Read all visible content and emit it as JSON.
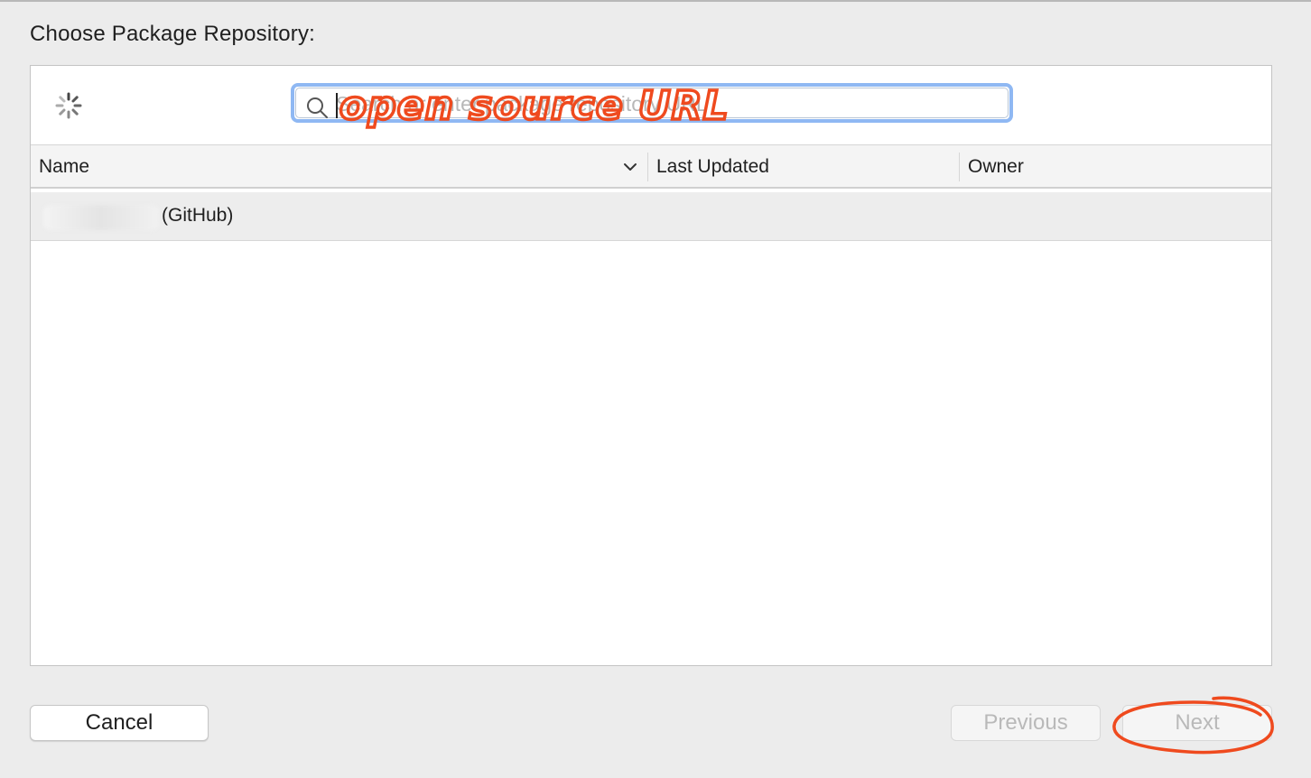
{
  "dialog": {
    "title": "Choose Package Repository:"
  },
  "search": {
    "placeholder": "Search or enter package repository URL",
    "value": "",
    "annotation": "open source URL"
  },
  "table": {
    "columns": [
      "Name",
      "Last Updated",
      "Owner"
    ],
    "rows": [
      {
        "name": "(GitHub)",
        "last_updated": "",
        "owner": ""
      }
    ]
  },
  "buttons": {
    "cancel": "Cancel",
    "previous": "Previous",
    "next": "Next"
  },
  "colors": {
    "annotation": "#ef4a1e",
    "focus_ring": "#8fb8f3"
  },
  "icons": [
    "loading-spinner-icon",
    "search-icon",
    "chevron-down-icon"
  ]
}
